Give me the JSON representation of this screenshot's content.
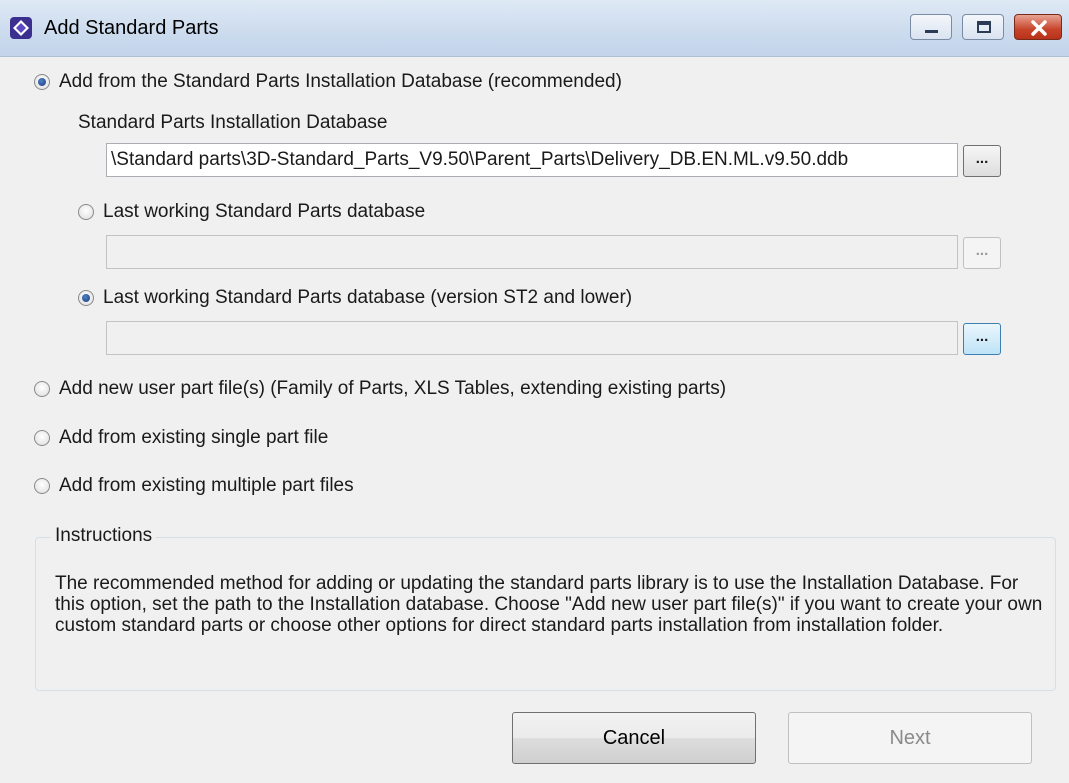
{
  "window": {
    "title": "Add Standard Parts",
    "icon": "app-icon"
  },
  "options": {
    "installation_db": {
      "label": "Add from the Standard Parts Installation Database (recommended)",
      "checked": true,
      "field_label": "Standard Parts Installation Database",
      "path": "\\Standard parts\\3D-Standard_Parts_V9.50\\Parent_Parts\\Delivery_DB.EN.ML.v9.50.ddb",
      "browse_label": "..."
    },
    "last_working": {
      "label": "Last working Standard Parts database",
      "checked": false,
      "path": "",
      "browse_label": "..."
    },
    "last_working_st2": {
      "label": "Last working Standard Parts database (version ST2 and lower)",
      "checked": true,
      "path": "",
      "browse_label": "..."
    },
    "user_part_files": {
      "label": "Add new user part file(s) (Family of Parts, XLS Tables, extending existing parts)",
      "checked": false
    },
    "single_part": {
      "label": "Add from existing single part file",
      "checked": false
    },
    "multiple_parts": {
      "label": "Add from existing multiple part files",
      "checked": false
    }
  },
  "instructions": {
    "title": "Instructions",
    "text": "The recommended method for adding or updating the standard parts library is to use the Installation Database. For this option, set the path to the Installation database. Choose \"Add new user part file(s)\" if you want to create your own custom standard parts or choose other options for direct standard parts installation from installation folder."
  },
  "buttons": {
    "cancel": "Cancel",
    "next": "Next"
  },
  "colors": {
    "titlebar": "#cddcee",
    "close_button": "#c7442a",
    "radio_selected": "#1b3f7e"
  }
}
